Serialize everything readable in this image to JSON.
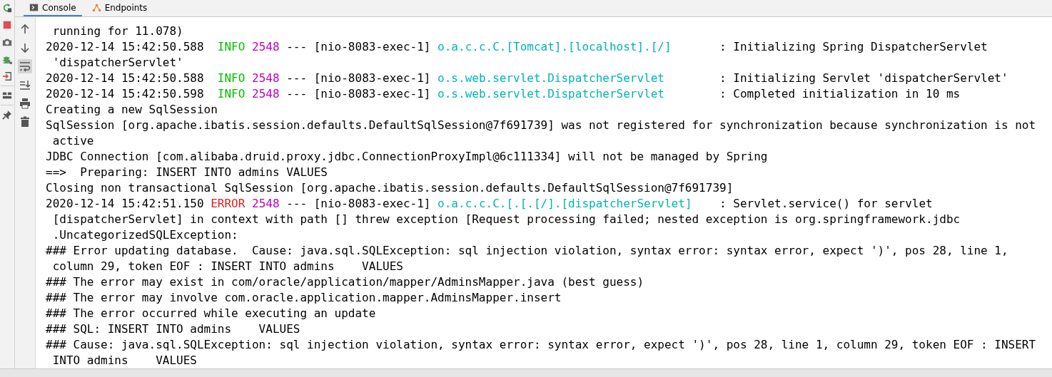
{
  "tabs": [
    {
      "label": "Console",
      "kind": "console",
      "selected": true
    },
    {
      "label": "Endpoints",
      "kind": "endpoints",
      "selected": false
    }
  ],
  "run_tools": [
    {
      "kind": "rerun"
    },
    {
      "kind": "stop"
    },
    {
      "kind": "camera"
    },
    {
      "kind": "debug"
    },
    {
      "kind": "exit"
    },
    {
      "kind": "layout"
    },
    {
      "kind": "pin"
    }
  ],
  "console_tools": [
    {
      "kind": "up",
      "selected": false
    },
    {
      "kind": "down",
      "selected": false
    },
    {
      "kind": "wrap",
      "selected": true
    },
    {
      "kind": "scroll-end",
      "selected": false
    },
    {
      "kind": "print",
      "selected": false
    },
    {
      "kind": "trash",
      "selected": false
    }
  ],
  "lines": [
    [
      {
        "kind": "plain",
        "text": " running for 11.078)"
      }
    ],
    [
      {
        "kind": "plain",
        "text": "2020-12-14 15:42:50.588  "
      },
      {
        "kind": "info",
        "text": "INFO"
      },
      {
        "kind": "pid",
        "text": " 2548"
      },
      {
        "kind": "plain",
        "text": " --- [nio-8083-exec-1] "
      },
      {
        "kind": "logger",
        "text": "o.a.c.c.C.[Tomcat].[localhost].[/]"
      },
      {
        "kind": "plain",
        "text": "       : Initializing Spring DispatcherServlet"
      }
    ],
    [
      {
        "kind": "plain",
        "text": " 'dispatcherServlet'"
      }
    ],
    [
      {
        "kind": "plain",
        "text": "2020-12-14 15:42:50.588  "
      },
      {
        "kind": "info",
        "text": "INFO"
      },
      {
        "kind": "pid",
        "text": " 2548"
      },
      {
        "kind": "plain",
        "text": " --- [nio-8083-exec-1] "
      },
      {
        "kind": "logger",
        "text": "o.s.web.servlet.DispatcherServlet"
      },
      {
        "kind": "plain",
        "text": "        : Initializing Servlet 'dispatcherServlet'"
      }
    ],
    [
      {
        "kind": "plain",
        "text": "2020-12-14 15:42:50.598  "
      },
      {
        "kind": "info",
        "text": "INFO"
      },
      {
        "kind": "pid",
        "text": " 2548"
      },
      {
        "kind": "plain",
        "text": " --- [nio-8083-exec-1] "
      },
      {
        "kind": "logger",
        "text": "o.s.web.servlet.DispatcherServlet"
      },
      {
        "kind": "plain",
        "text": "        : Completed initialization in 10 ms"
      }
    ],
    [
      {
        "kind": "plain",
        "text": "Creating a new SqlSession"
      }
    ],
    [
      {
        "kind": "plain",
        "text": "SqlSession [org.apache.ibatis.session.defaults.DefaultSqlSession@7f691739] was not registered for synchronization because synchronization is not"
      }
    ],
    [
      {
        "kind": "plain",
        "text": " active"
      }
    ],
    [
      {
        "kind": "plain",
        "text": "JDBC Connection [com.alibaba.druid.proxy.jdbc.ConnectionProxyImpl@6c111334] will not be managed by Spring"
      }
    ],
    [
      {
        "kind": "plain",
        "text": "==>  Preparing: INSERT INTO admins VALUES"
      }
    ],
    [
      {
        "kind": "plain",
        "text": "Closing non transactional SqlSession [org.apache.ibatis.session.defaults.DefaultSqlSession@7f691739]"
      }
    ],
    [
      {
        "kind": "plain",
        "text": "2020-12-14 15:42:51.150 "
      },
      {
        "kind": "error",
        "text": "ERROR"
      },
      {
        "kind": "pid",
        "text": " 2548"
      },
      {
        "kind": "plain",
        "text": " --- [nio-8083-exec-1] "
      },
      {
        "kind": "logger",
        "text": "o.a.c.c.C.[.[.[/].[dispatcherServlet]"
      },
      {
        "kind": "plain",
        "text": "    : Servlet.service() for servlet"
      }
    ],
    [
      {
        "kind": "plain",
        "text": " [dispatcherServlet] in context with path [] threw exception [Request processing failed; nested exception is org.springframework.jdbc"
      }
    ],
    [
      {
        "kind": "plain",
        "text": " .UncategorizedSQLException:"
      }
    ],
    [
      {
        "kind": "plain",
        "text": "### Error updating database.  Cause: java.sql.SQLException: sql injection violation, syntax error: syntax error, expect ')', pos 28, line 1,"
      }
    ],
    [
      {
        "kind": "plain",
        "text": " column 29, token EOF : INSERT INTO admins    VALUES"
      }
    ],
    [
      {
        "kind": "plain",
        "text": "### The error may exist in com/oracle/application/mapper/AdminsMapper.java (best guess)"
      }
    ],
    [
      {
        "kind": "plain",
        "text": "### The error may involve com.oracle.application.mapper.AdminsMapper.insert"
      }
    ],
    [
      {
        "kind": "plain",
        "text": "### The error occurred while executing an update"
      }
    ],
    [
      {
        "kind": "plain",
        "text": "### SQL: INSERT INTO admins    VALUES"
      }
    ],
    [
      {
        "kind": "plain",
        "text": "### Cause: java.sql.SQLException: sql injection violation, syntax error: syntax error, expect ')', pos 28, line 1, column 29, token EOF : INSERT"
      }
    ],
    [
      {
        "kind": "plain",
        "text": " INTO admins    VALUES"
      }
    ]
  ]
}
